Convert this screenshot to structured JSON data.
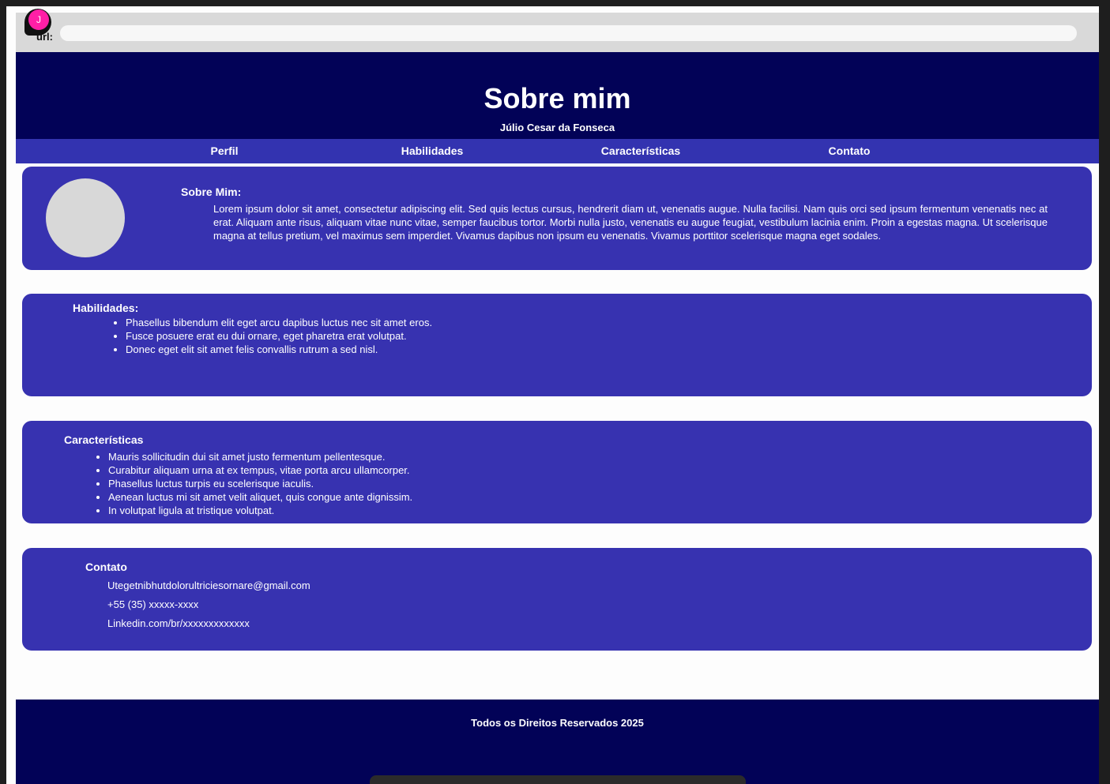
{
  "browser": {
    "url_label": "url:",
    "url_value": "",
    "profile_initial": "J",
    "profile_color": "#ff1fa6"
  },
  "header": {
    "title": "Sobre mim",
    "subtitle": "Júlio Cesar da Fonseca"
  },
  "nav": {
    "items": [
      {
        "label": "Perfil"
      },
      {
        "label": "Habilidades"
      },
      {
        "label": "Características"
      },
      {
        "label": "Contato"
      }
    ]
  },
  "sobre": {
    "heading": "Sobre Mim:",
    "text": "Lorem ipsum dolor sit amet, consectetur adipiscing elit. Sed quis lectus cursus, hendrerit diam ut, venenatis augue. Nulla facilisi. Nam quis orci sed ipsum fermentum venenatis nec at erat. Aliquam ante risus, aliquam vitae nunc vitae, semper faucibus tortor. Morbi nulla justo, venenatis eu augue feugiat, vestibulum lacinia enim. Proin a egestas magna. Ut scelerisque magna at tellus pretium, vel maximus sem imperdiet. Vivamus dapibus non ipsum eu venenatis. Vivamus porttitor scelerisque magna eget sodales."
  },
  "habilidades": {
    "heading": "Habilidades:",
    "items": [
      "Phasellus bibendum elit eget arcu dapibus luctus nec sit amet eros.",
      "Fusce posuere erat eu dui ornare, eget pharetra erat volutpat.",
      "Donec eget elit sit amet felis convallis rutrum a sed nisl."
    ]
  },
  "caracteristicas": {
    "heading": "Características",
    "items": [
      "Mauris sollicitudin dui sit amet justo fermentum pellentesque.",
      "Curabitur aliquam urna at ex tempus, vitae porta arcu ullamcorper.",
      "Phasellus luctus turpis eu scelerisque iaculis.",
      "Aenean luctus mi sit amet velit aliquet, quis congue ante dignissim.",
      "In volutpat ligula at tristique volutpat."
    ]
  },
  "contato": {
    "heading": "Contato",
    "email": "Utegetnibhutdolorultriciesornare@gmail.com",
    "phone": "+55 (35) xxxxx-xxxx",
    "linkedin": "Linkedin.com/br/xxxxxxxxxxxxx"
  },
  "footer": {
    "text": "Todos os Direitos Reservados 2025"
  },
  "colors": {
    "header_bg": "#020257",
    "nav_bg": "#3333b0",
    "card_bg": "#3732b0",
    "footer_bg": "#020257"
  }
}
